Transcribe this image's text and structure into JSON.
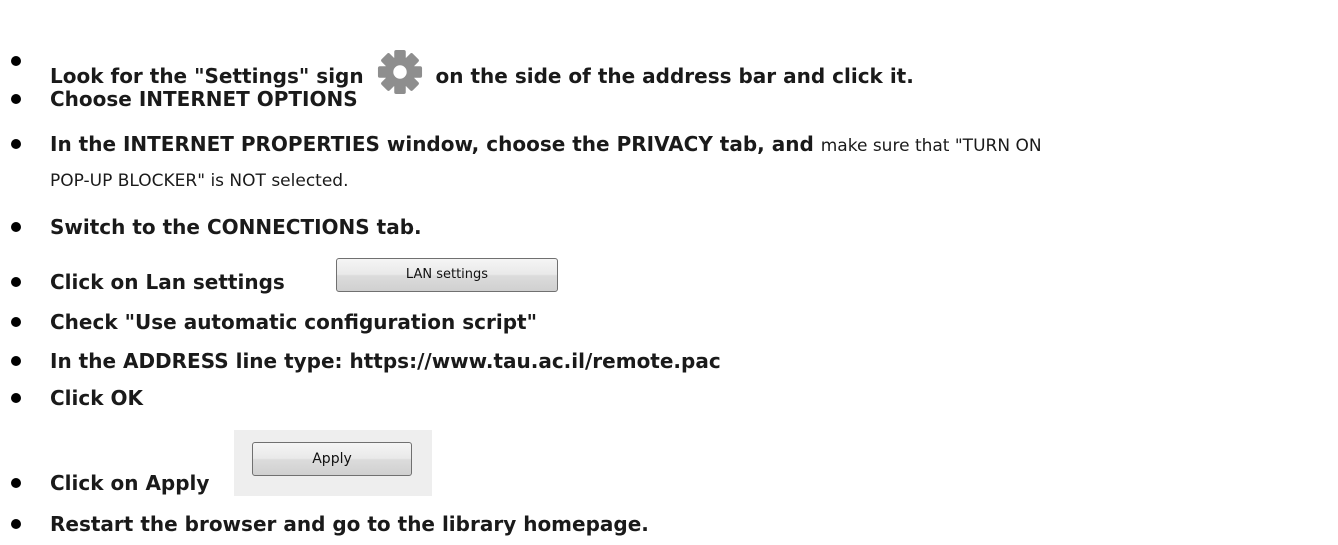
{
  "steps": [
    {
      "pre": "Look for the \"Settings\" sign",
      "post": "on the side of the address bar and click it.",
      "icon": "gear-icon"
    },
    {
      "text": "Choose INTERNET OPTIONS"
    },
    {
      "bold": "In the INTERNET PROPERTIES window, choose the PRIVACY tab, and",
      "normal": "make sure that \"TURN ON",
      "line2": "POP-UP BLOCKER\" is NOT selected."
    },
    {
      "text": "Switch to the CONNECTIONS tab."
    },
    {
      "text": "Click on Lan settings",
      "button": "LAN settings"
    },
    {
      "text": "Check \"Use automatic configuration script\""
    },
    {
      "text": "In the ADDRESS line type: https://www.tau.ac.il/remote.pac"
    },
    {
      "text": "Click OK"
    },
    {
      "text": "Click on Apply",
      "button": "Apply"
    },
    {
      "text": "Restart the browser and go to the library homepage."
    }
  ]
}
